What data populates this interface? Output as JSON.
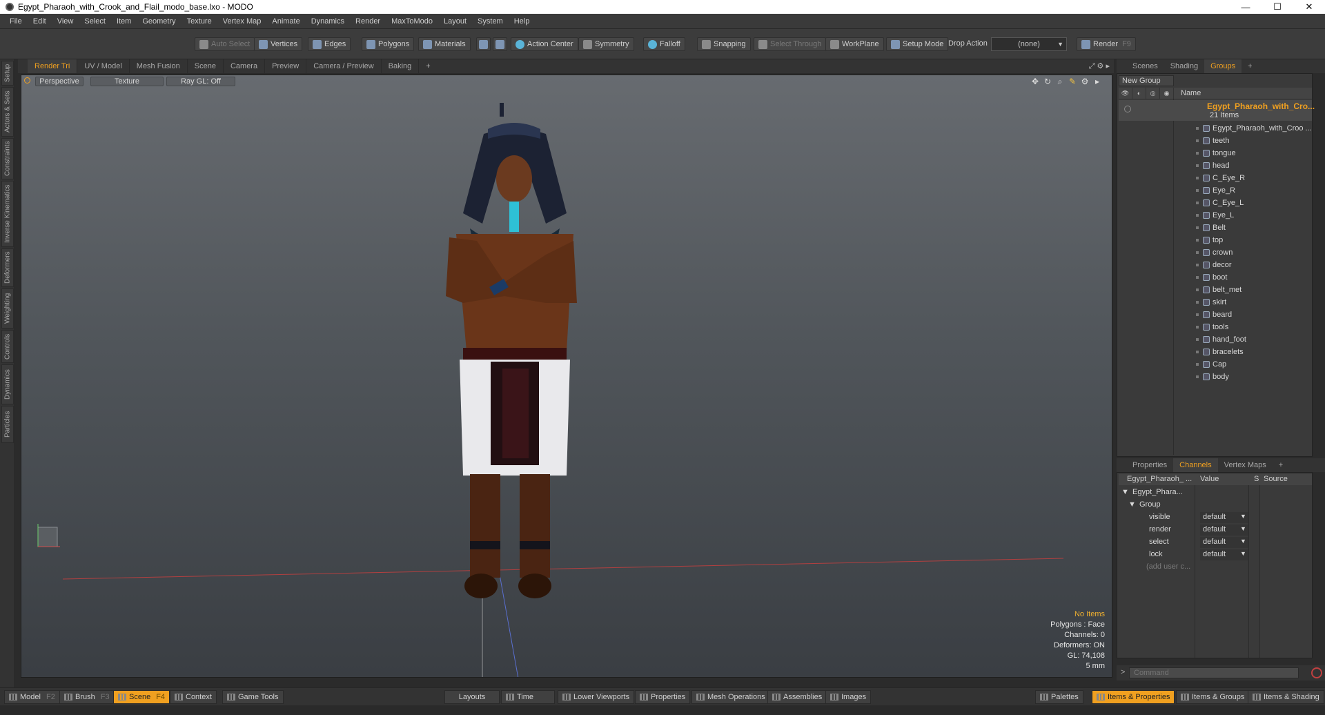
{
  "window": {
    "title": "Egypt_Pharaoh_with_Crook_and_Flail_modo_base.lxo - MODO",
    "minimize": "—",
    "maximize": "☐",
    "close": "✕"
  },
  "menu": [
    "File",
    "Edit",
    "View",
    "Select",
    "Item",
    "Geometry",
    "Texture",
    "Vertex Map",
    "Animate",
    "Dynamics",
    "Render",
    "MaxToModo",
    "Layout",
    "System",
    "Help"
  ],
  "toolbar": {
    "auto_select": "Auto Select",
    "vertices": "Vertices",
    "edges": "Edges",
    "polygons": "Polygons",
    "materials": "Materials",
    "action_center": "Action Center",
    "symmetry": "Symmetry",
    "falloff": "Falloff",
    "snapping": "Snapping",
    "select_through": "Select Through",
    "workplane": "WorkPlane",
    "setup_mode": "Setup Mode",
    "drop_action": "Drop Action",
    "drop_value": "(none)",
    "render": "Render",
    "render_key": "F9"
  },
  "left_tabs": [
    "Setup",
    "Actors & Sets",
    "Constraints",
    "Inverse Kinematics",
    "Deformers",
    "Weighting",
    "Controls",
    "Dynamics",
    "Particles"
  ],
  "viewport_tabs": [
    "Render Tri",
    "UV / Model",
    "Mesh Fusion",
    "Scene",
    "Camera",
    "Preview",
    "Camera / Preview",
    "Baking",
    "+"
  ],
  "viewport": {
    "view": "Perspective",
    "shading": "Texture",
    "raygl": "Ray GL: Off",
    "info": {
      "items": "No Items",
      "polygons": "Polygons : Face",
      "channels": "Channels: 0",
      "deformers": "Deformers: ON",
      "gl": "GL: 74,108",
      "scale": "5 mm"
    }
  },
  "right_tabs": [
    "Scenes",
    "Shading",
    "Groups",
    "+"
  ],
  "groups": {
    "new_group": "New Group",
    "name_col": "Name",
    "root_name": "Egypt_Pharaoh_with_Cro...",
    "root_count": "21 Items",
    "items": [
      "Egypt_Pharaoh_with_Croo ...",
      "teeth",
      "tongue",
      "head",
      "C_Eye_R",
      "Eye_R",
      "C_Eye_L",
      "Eye_L",
      "Belt",
      "top",
      "crown",
      "decor",
      "boot",
      "belt_met",
      "skirt",
      "beard",
      "tools",
      "hand_foot",
      "bracelets",
      "Cap",
      "body"
    ]
  },
  "channel_tabs": [
    "Properties",
    "Channels",
    "Vertex Maps",
    "+"
  ],
  "channels": {
    "col_name": "Egypt_Pharaoh_ ...",
    "col_value": "Value",
    "col_s": "S",
    "col_source": "Source",
    "root": "Egypt_Phara...",
    "group": "Group",
    "rows": [
      {
        "name": "visible",
        "value": "default"
      },
      {
        "name": "render",
        "value": "default"
      },
      {
        "name": "select",
        "value": "default"
      },
      {
        "name": "lock",
        "value": "default"
      }
    ],
    "add_user": "(add user c..."
  },
  "command": {
    "placeholder": "Command",
    "prompt": ">"
  },
  "bottom": {
    "model": "Model",
    "model_key": "F2",
    "brush": "Brush",
    "brush_key": "F3",
    "scene": "Scene",
    "scene_key": "F4",
    "context": "Context",
    "game_tools": "Game Tools",
    "layouts": "Layouts",
    "time": "Time",
    "lower_viewports": "Lower Viewports",
    "properties": "Properties",
    "mesh_operations": "Mesh Operations",
    "assemblies": "Assemblies",
    "images": "Images",
    "palettes": "Palettes",
    "items_props": "Items & Properties",
    "items_groups": "Items & Groups",
    "items_shading": "Items & Shading"
  },
  "colors": {
    "accent": "#f0a020",
    "background": "#3a3a3a",
    "viewport_top": "#676b70"
  }
}
